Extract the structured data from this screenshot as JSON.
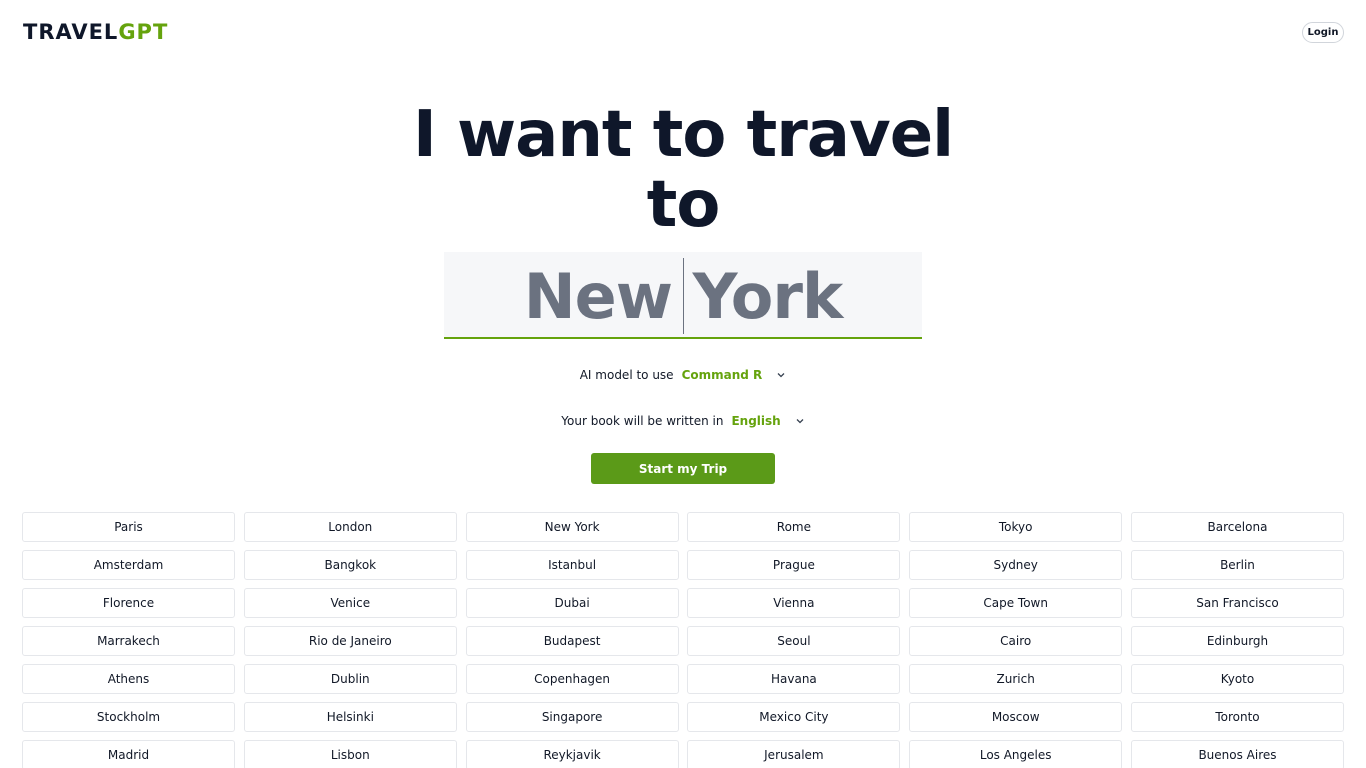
{
  "header": {
    "logo_part1": "TRAVEL",
    "logo_part2": "GPT",
    "login_label": "Login"
  },
  "hero": {
    "headline": "I want to travel to",
    "destination_value": "New York"
  },
  "model_select": {
    "label": "AI model to use",
    "value": "Command R"
  },
  "language_select": {
    "label": "Your book will be written in",
    "value": "English"
  },
  "start_button": "Start my Trip",
  "cities": [
    "Paris",
    "London",
    "New York",
    "Rome",
    "Tokyo",
    "Barcelona",
    "Amsterdam",
    "Bangkok",
    "Istanbul",
    "Prague",
    "Sydney",
    "Berlin",
    "Florence",
    "Venice",
    "Dubai",
    "Vienna",
    "Cape Town",
    "San Francisco",
    "Marrakech",
    "Rio de Janeiro",
    "Budapest",
    "Seoul",
    "Cairo",
    "Edinburgh",
    "Athens",
    "Dublin",
    "Copenhagen",
    "Havana",
    "Zurich",
    "Kyoto",
    "Stockholm",
    "Helsinki",
    "Singapore",
    "Mexico City",
    "Moscow",
    "Toronto",
    "Madrid",
    "Lisbon",
    "Reykjavik",
    "Jerusalem",
    "Los Angeles",
    "Buenos Aires"
  ],
  "colors": {
    "accent": "#65a30d",
    "button": "#5b9a18",
    "heading": "#0f172a",
    "input_text": "#6b7280"
  },
  "icons": {
    "select_chevron": "chevron-down-icon"
  }
}
